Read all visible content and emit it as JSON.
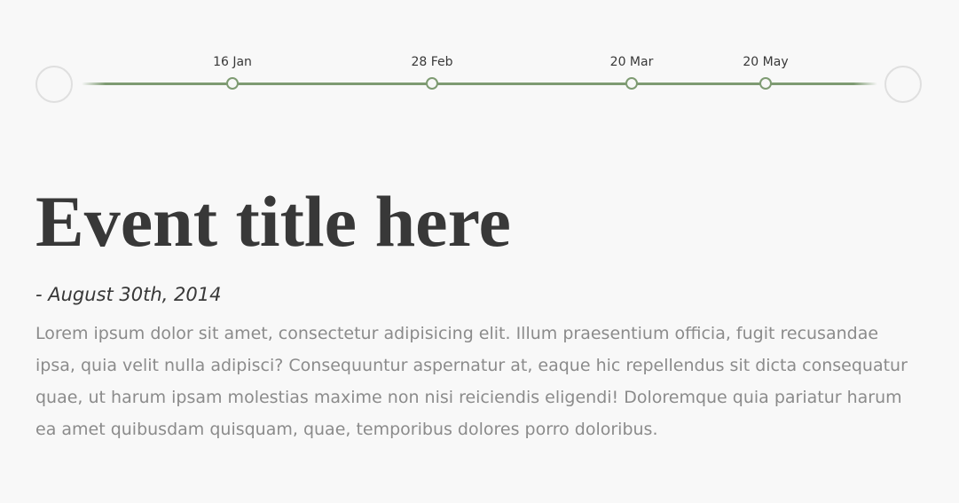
{
  "timeline": {
    "events": [
      {
        "date": "16 Jan"
      },
      {
        "date": "28 Feb"
      },
      {
        "date": "20 Mar"
      },
      {
        "date": "20 May"
      }
    ]
  },
  "event": {
    "title": "Event title here",
    "date": "- August 30th, 2014",
    "body": "Lorem ipsum dolor sit amet, consectetur adipisicing elit. Illum praesentium officia, fugit recusandae ipsa, quia velit nulla adipisci? Consequuntur aspernatur at, eaque hic repellendus sit dicta consequatur quae, ut harum ipsam molestias maxime non nisi reiciendis eligendi! Doloremque quia pariatur harum ea amet quibusdam quisquam, quae, temporibus dolores porro doloribus."
  },
  "colors": {
    "accent": "#7e9b72",
    "background": "#f8f8f8",
    "text": "#383838",
    "muted_text": "#8b8b8b",
    "nav_border": "#dfdfdf"
  }
}
